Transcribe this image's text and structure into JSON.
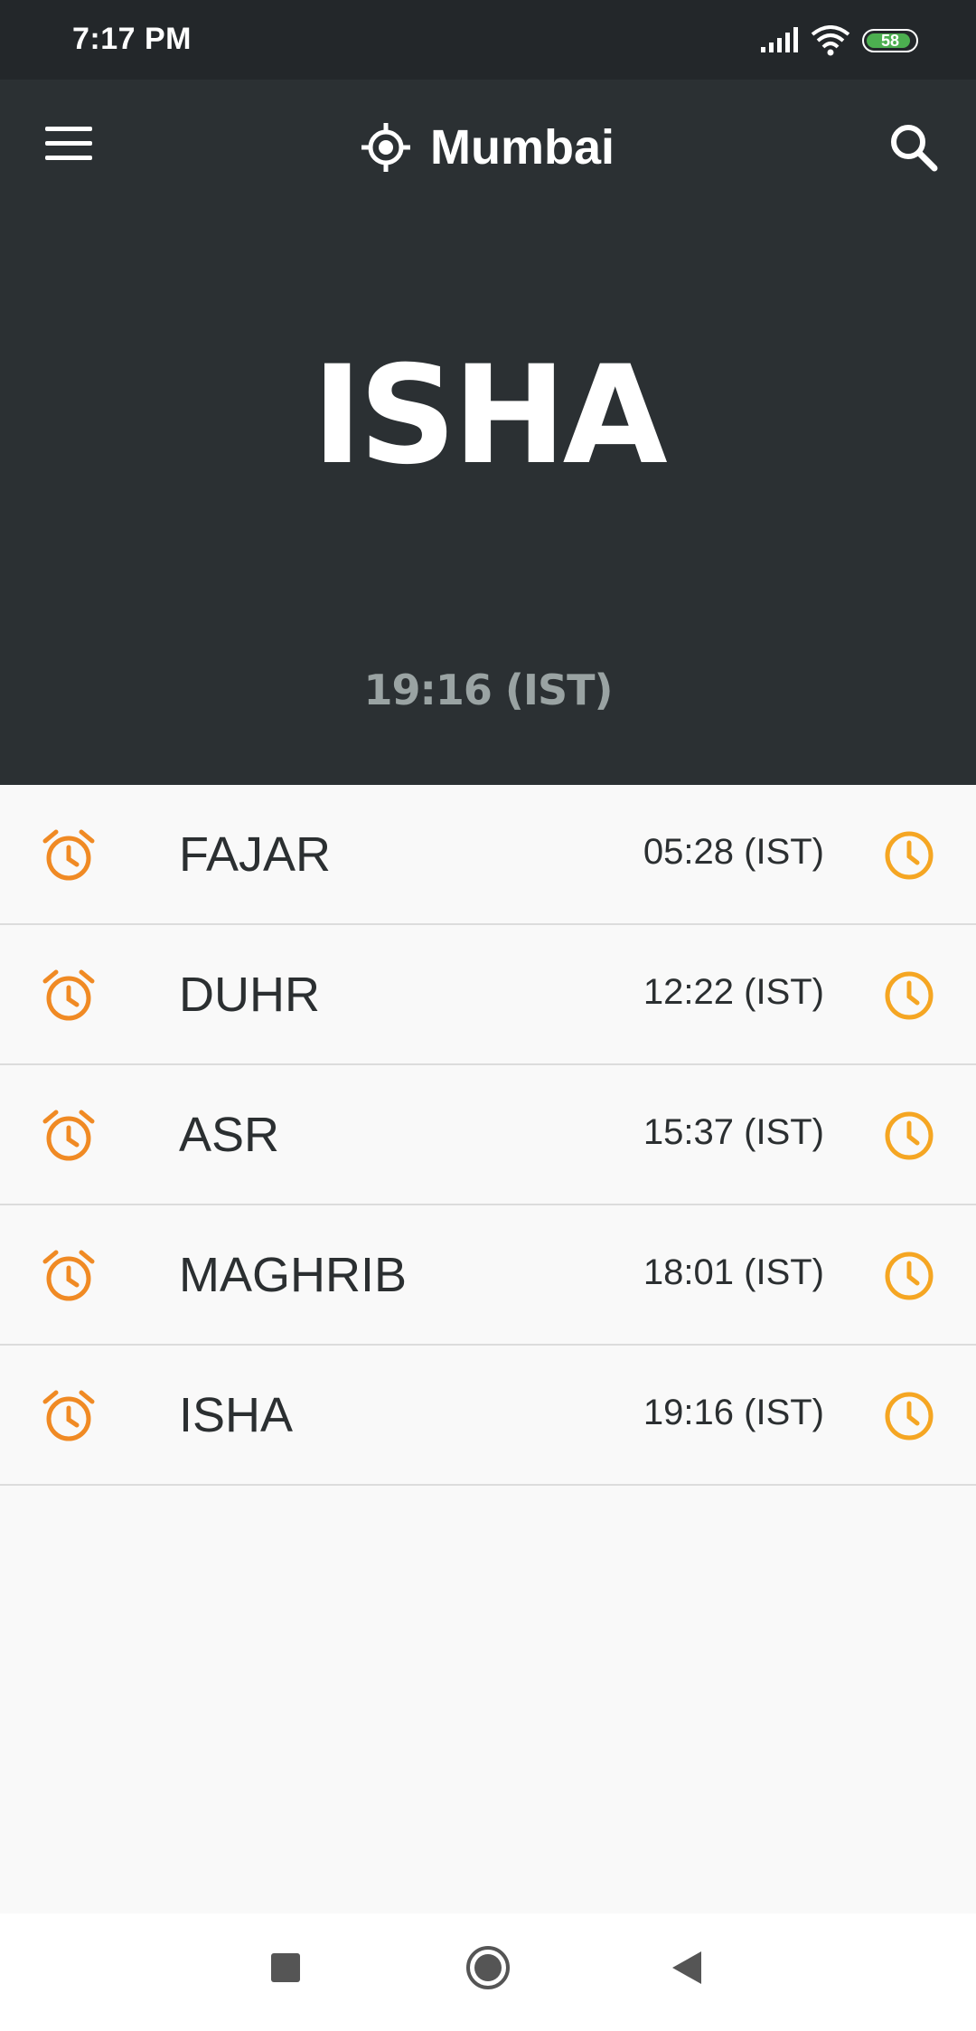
{
  "status_bar": {
    "time": "7:17 PM",
    "battery": "58",
    "battery_color": "#4caf50"
  },
  "header": {
    "location": "Mumbai",
    "current_prayer": "ISHA",
    "current_time": "19:16 (IST)"
  },
  "colors": {
    "header_bg": "#2b3033",
    "alarm_icon": "#f08a24",
    "clock_icon": "#f5a623"
  },
  "prayers": [
    {
      "name": "FAJAR",
      "time": "05:28 (IST)"
    },
    {
      "name": "DUHR",
      "time": "12:22 (IST)"
    },
    {
      "name": "ASR",
      "time": "15:37 (IST)"
    },
    {
      "name": "MAGHRIB",
      "time": "18:01 (IST)"
    },
    {
      "name": "ISHA",
      "time": "19:16 (IST)"
    }
  ]
}
